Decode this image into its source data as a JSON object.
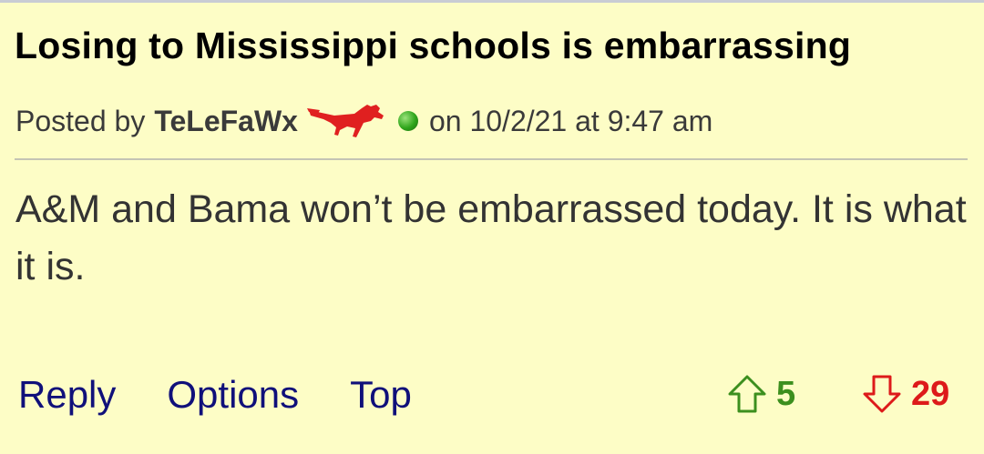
{
  "post": {
    "title": "Losing to Mississippi schools is embarrassing",
    "posted_by_label": "Posted by",
    "author": "TeLeFaWx",
    "date_text": "on 10/2/21 at 9:47 am",
    "body": "A&M and Bama won’t be embarrassed today. It is what it is.",
    "icons": {
      "mascot": "red-mustang-icon",
      "status": "online-status-icon",
      "upvote": "upvote-arrow-icon",
      "downvote": "downvote-arrow-icon"
    }
  },
  "actions": {
    "reply_label": "Reply",
    "options_label": "Options",
    "top_label": "Top"
  },
  "votes": {
    "up": "5",
    "down": "29"
  },
  "colors": {
    "background": "#fdfdc6",
    "link": "#10107a",
    "upvote": "#3c8f1e",
    "downvote": "#dd1a1a",
    "mascot": "#e02020"
  }
}
